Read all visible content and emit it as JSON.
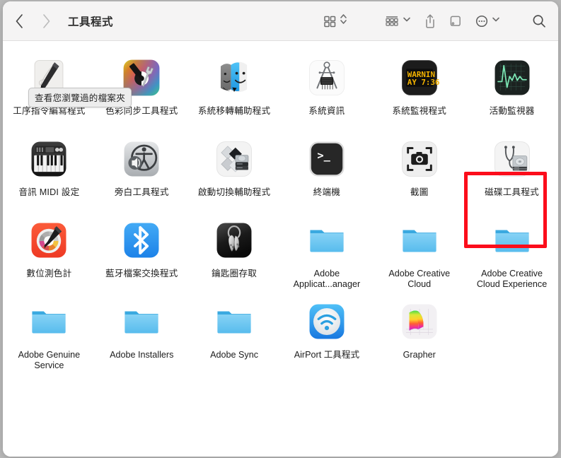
{
  "window": {
    "title": "工具程式",
    "background_color": "#ffffff",
    "toolbar_color": "#f5f4f4"
  },
  "toolbar": {
    "back_label": "‹",
    "forward_label": "›",
    "back_enabled": true,
    "forward_enabled": false,
    "buttons": [
      {
        "name": "icon-view-button",
        "icon": "grid-view-icon",
        "has_caret": true,
        "caret": "updown-caret-icon"
      },
      {
        "name": "group-by-button",
        "icon": "list-group-icon",
        "has_caret": true,
        "caret": "chevron-down-icon"
      },
      {
        "name": "share-button",
        "icon": "share-icon",
        "has_caret": false
      },
      {
        "name": "tag-button",
        "icon": "tag-icon",
        "has_caret": false
      },
      {
        "name": "more-actions-button",
        "icon": "ellipsis-circle-icon",
        "has_caret": true,
        "caret": "chevron-down-icon"
      },
      {
        "name": "search-button",
        "icon": "search-icon",
        "has_caret": false
      }
    ]
  },
  "tooltip": {
    "text": "查看您瀏覽過的檔案夾",
    "visible": true,
    "background": "#ededed",
    "border": "#c2c2c2"
  },
  "highlight": {
    "color": "#fc0d1b",
    "target": "磁碟工具程式",
    "visible": true
  },
  "grid": {
    "columns": 6,
    "rows": [
      [
        {
          "label": "工序指令編寫程式",
          "icon": "script-editor-icon",
          "type": "app",
          "cjk": true
        },
        {
          "label": "色彩同步工具程式",
          "icon": "colorsync-utility-icon",
          "type": "app",
          "cjk": true
        },
        {
          "label": "系統移轉輔助程式",
          "icon": "migration-assistant-icon",
          "type": "app",
          "cjk": true
        },
        {
          "label": "系統資訊",
          "icon": "system-information-icon",
          "type": "app",
          "cjk": true
        },
        {
          "label": "系統監視程式",
          "icon": "console-icon",
          "type": "app",
          "cjk": true
        },
        {
          "label": "活動監視器",
          "icon": "activity-monitor-icon",
          "type": "app",
          "cjk": true
        }
      ],
      [
        {
          "label": "音訊 MIDI 設定",
          "icon": "audio-midi-setup-icon",
          "type": "app",
          "cjk": true
        },
        {
          "label": "旁白工具程式",
          "icon": "voiceover-utility-icon",
          "type": "app",
          "cjk": true
        },
        {
          "label": "啟動切換輔助程式",
          "icon": "boot-camp-assistant-icon",
          "type": "app",
          "cjk": true
        },
        {
          "label": "終端機",
          "icon": "terminal-icon",
          "type": "app",
          "cjk": true
        },
        {
          "label": "截圖",
          "icon": "screenshot-icon",
          "type": "app",
          "cjk": true
        },
        {
          "label": "磁碟工具程式",
          "icon": "disk-utility-icon",
          "type": "app",
          "cjk": true,
          "highlighted": true
        }
      ],
      [
        {
          "label": "數位測色計",
          "icon": "digital-color-meter-icon",
          "type": "app",
          "cjk": true
        },
        {
          "label": "藍牙檔案交換程式",
          "icon": "bluetooth-file-exchange-icon",
          "type": "app",
          "cjk": true
        },
        {
          "label": "鑰匙圈存取",
          "icon": "keychain-access-icon",
          "type": "app",
          "cjk": true
        },
        {
          "label": "Adobe Applicat...anager",
          "icon": "folder-icon",
          "type": "folder"
        },
        {
          "label": "Adobe Creative Cloud",
          "icon": "folder-icon",
          "type": "folder"
        },
        {
          "label": "Adobe Creative Cloud Experience",
          "icon": "folder-icon",
          "type": "folder"
        }
      ],
      [
        {
          "label": "Adobe Genuine Service",
          "icon": "folder-icon",
          "type": "folder"
        },
        {
          "label": "Adobe Installers",
          "icon": "folder-icon",
          "type": "folder"
        },
        {
          "label": "Adobe Sync",
          "icon": "folder-icon",
          "type": "folder"
        },
        {
          "label": "AirPort 工具程式",
          "icon": "airport-utility-icon",
          "type": "app"
        },
        {
          "label": "Grapher",
          "icon": "grapher-icon",
          "type": "app"
        },
        {
          "label": "",
          "icon": "",
          "type": "empty"
        }
      ]
    ]
  },
  "console_icon_text": {
    "line1": "WARNIN",
    "line2": "AY 7:36"
  },
  "terminal_icon_text": ">_"
}
